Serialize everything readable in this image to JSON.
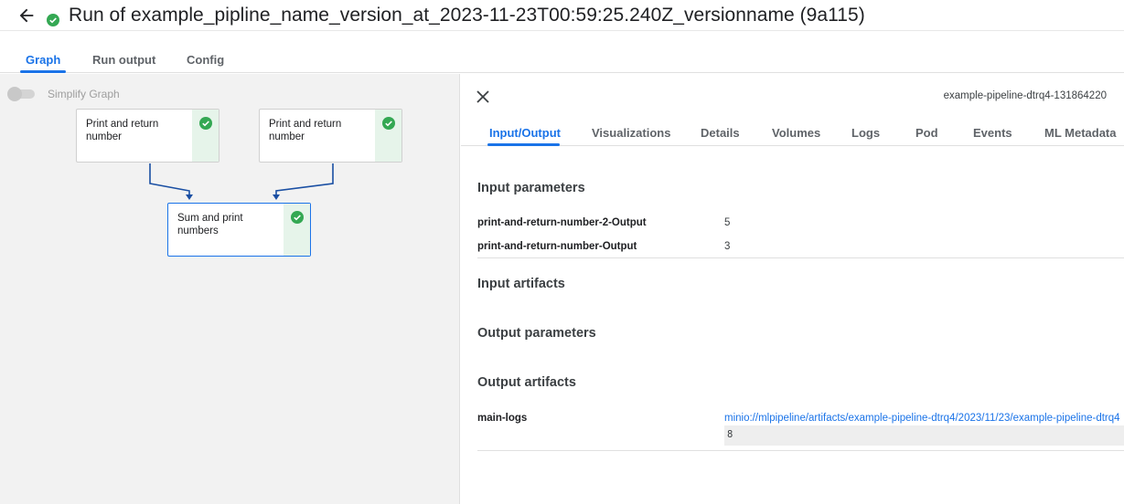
{
  "header": {
    "title": "Run of example_pipline_name_version_at_2023-11-23T00:59:25.240Z_versionname (9a115)",
    "back_icon": "arrow-back-icon",
    "status_icon": "check-circle-icon",
    "status_color": "#34a853"
  },
  "main_tabs": [
    {
      "label": "Graph",
      "active": true
    },
    {
      "label": "Run output",
      "active": false
    },
    {
      "label": "Config",
      "active": false
    }
  ],
  "graph": {
    "simplify_label": "Simplify Graph",
    "simplify_enabled": false,
    "nodes": [
      {
        "label": "Print and return number",
        "status": "succeeded"
      },
      {
        "label": "Print and return number",
        "status": "succeeded"
      },
      {
        "label": "Sum and print numbers",
        "status": "succeeded",
        "selected": true
      }
    ]
  },
  "details": {
    "pod_name": "example-pipeline-dtrq4-131864220",
    "tabs": [
      {
        "label": "Input/Output",
        "active": true
      },
      {
        "label": "Visualizations",
        "active": false
      },
      {
        "label": "Details",
        "active": false
      },
      {
        "label": "Volumes",
        "active": false
      },
      {
        "label": "Logs",
        "active": false
      },
      {
        "label": "Pod",
        "active": false
      },
      {
        "label": "Events",
        "active": false
      },
      {
        "label": "ML Metadata",
        "active": false
      }
    ],
    "input_parameters": {
      "title": "Input parameters",
      "rows": [
        {
          "key": "print-and-return-number-2-Output",
          "value": "5"
        },
        {
          "key": "print-and-return-number-Output",
          "value": "3"
        }
      ]
    },
    "input_artifacts_title": "Input artifacts",
    "output_parameters_title": "Output parameters",
    "output_artifacts": {
      "title": "Output artifacts",
      "rows": [
        {
          "key": "main-logs",
          "link": "minio://mlpipeline/artifacts/example-pipeline-dtrq4/2023/11/23/example-pipeline-dtrq4",
          "preview": "8"
        }
      ]
    }
  }
}
